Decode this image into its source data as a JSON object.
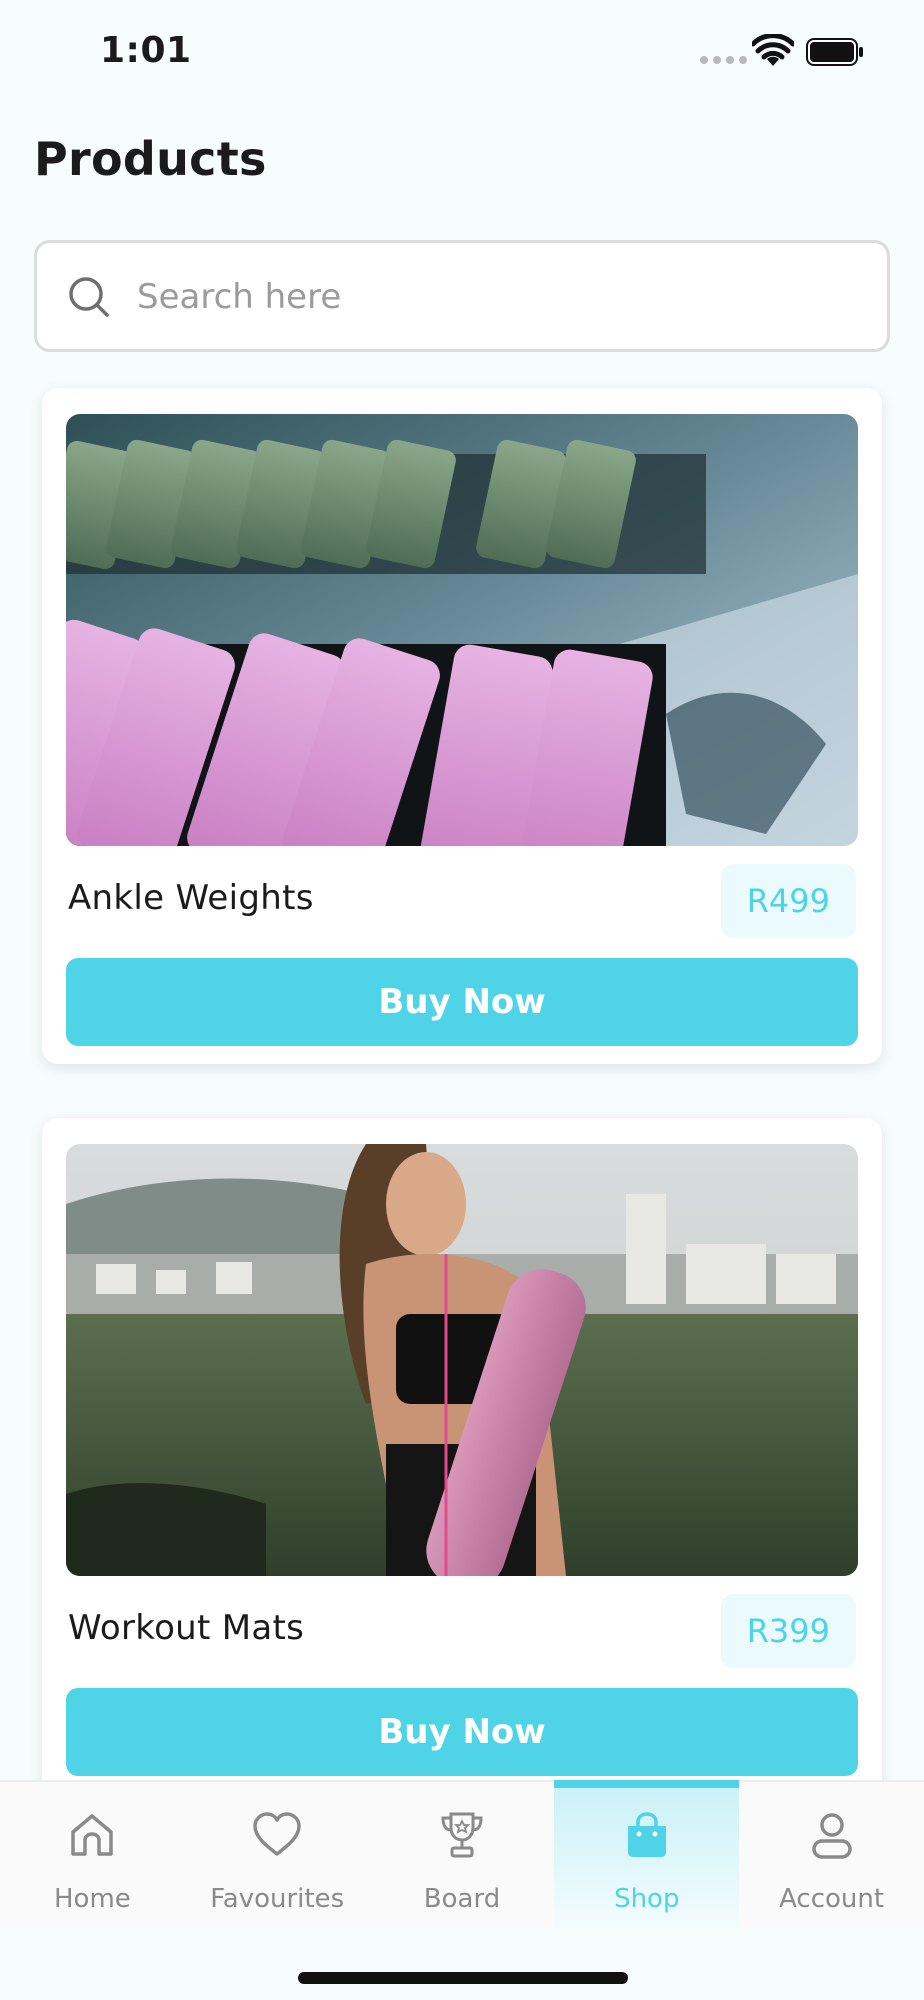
{
  "status_bar": {
    "time": "1:01"
  },
  "page": {
    "title": "Products"
  },
  "search": {
    "placeholder": "Search here"
  },
  "products": [
    {
      "name": "Ankle Weights",
      "price": "R499",
      "buy_label": "Buy Now",
      "image": "ankle-weights-photo"
    },
    {
      "name": "Workout Mats",
      "price": "R399",
      "buy_label": "Buy Now",
      "image": "workout-mat-photo"
    }
  ],
  "nav": {
    "items": [
      {
        "label": "Home",
        "icon": "home-icon"
      },
      {
        "label": "Favourites",
        "icon": "heart-icon"
      },
      {
        "label": "Board",
        "icon": "trophy-icon"
      },
      {
        "label": "Shop",
        "icon": "shopping-bag-icon"
      },
      {
        "label": "Account",
        "icon": "user-icon"
      }
    ],
    "active": "Shop"
  },
  "colors": {
    "accent": "#4fd3e6",
    "price_bg": "#ebfafc",
    "background": "#f7fcfd"
  }
}
